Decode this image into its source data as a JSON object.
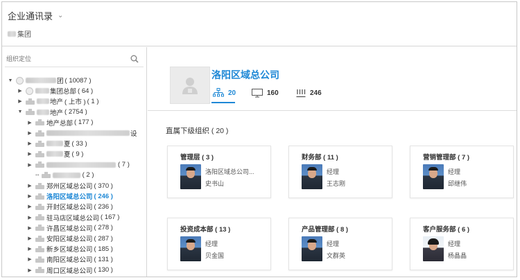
{
  "header": {
    "app_title": "企业通讯录",
    "org_name_suffix": "集团"
  },
  "sidebar": {
    "search_placeholder": "组织定位",
    "tree": [
      {
        "label": "团",
        "count": "( 10087 )",
        "level": 0,
        "expanded": true,
        "icon": "globe-icon",
        "blur": 44
      },
      {
        "label": "集团总部",
        "count": "( 64 )",
        "level": 1,
        "expanded": false,
        "icon": "globe-icon",
        "blur": 20
      },
      {
        "label": "地产",
        "count": "( 上市 )",
        "extra": "( 1 )",
        "level": 1,
        "expanded": false,
        "icon": "folder-icon",
        "blur": 18
      },
      {
        "label": "地产",
        "count": "( 2754 )",
        "level": 1,
        "expanded": true,
        "icon": "folder-icon",
        "blur": 18
      },
      {
        "label": "地产总部",
        "count": "( 177 )",
        "level": 2,
        "expanded": false,
        "icon": "folder-icon",
        "blur": 0
      },
      {
        "label": "设",
        "count": "",
        "level": 2,
        "expanded": false,
        "icon": "folder-icon",
        "blur": 120
      },
      {
        "label": "夏",
        "count": "( 33 )",
        "level": 2,
        "expanded": false,
        "icon": "folder-icon",
        "blur": 24
      },
      {
        "label": "夏",
        "count": "( 9 )",
        "level": 2,
        "expanded": false,
        "icon": "folder-icon",
        "blur": 24
      },
      {
        "label": "",
        "count": "( 7 )",
        "level": 2,
        "expanded": false,
        "icon": "folder-icon",
        "blur": 100
      },
      {
        "label": "",
        "count": "( 2 )",
        "level": 2,
        "expanded": false,
        "icon": "folder-icon",
        "blur": 40,
        "dots": true
      },
      {
        "label": "郑州区域总公司",
        "count": "( 370 )",
        "level": 2,
        "expanded": false,
        "icon": "folder-icon",
        "blur": 0
      },
      {
        "label": "洛阳区域总公司",
        "count": "( 246 )",
        "level": 2,
        "expanded": false,
        "icon": "folder-icon",
        "blur": 0,
        "active": true
      },
      {
        "label": "开封区域总公司",
        "count": "( 236 )",
        "level": 2,
        "expanded": false,
        "icon": "folder-icon",
        "blur": 0
      },
      {
        "label": "驻马店区域总公司",
        "count": "( 167 )",
        "level": 2,
        "expanded": false,
        "icon": "folder-icon",
        "blur": 0
      },
      {
        "label": "许昌区域总公司",
        "count": "( 278 )",
        "level": 2,
        "expanded": false,
        "icon": "folder-icon",
        "blur": 0
      },
      {
        "label": "安阳区域总公司",
        "count": "( 287 )",
        "level": 2,
        "expanded": false,
        "icon": "folder-icon",
        "blur": 0
      },
      {
        "label": "新乡区域总公司",
        "count": "( 185 )",
        "level": 2,
        "expanded": false,
        "icon": "folder-icon",
        "blur": 0
      },
      {
        "label": "南阳区域总公司",
        "count": "( 131 )",
        "level": 2,
        "expanded": false,
        "icon": "folder-icon",
        "blur": 0
      },
      {
        "label": "周口区域总公司",
        "count": "( 130 )",
        "level": 2,
        "expanded": false,
        "icon": "folder-icon",
        "blur": 0
      }
    ]
  },
  "main": {
    "company_name": "洛阳区域总公司",
    "stats": {
      "org_count": "20",
      "device_count": "160",
      "member_count": "246"
    },
    "section_title": "直属下级组织 ( 20 )",
    "cards": [
      {
        "title": "管理层 ( 3 )",
        "role": "洛阳区域总公司...",
        "person": "史书山",
        "female": false
      },
      {
        "title": "财务部 ( 11 )",
        "role": "经理",
        "person": "王志刚",
        "female": false
      },
      {
        "title": "营销管理部 ( 7 )",
        "role": "经理",
        "person": "邱继伟",
        "female": false
      },
      {
        "title": "投资成本部 ( 13 )",
        "role": "经理",
        "person": "贝金国",
        "female": false
      },
      {
        "title": "产品管理部 ( 8 )",
        "role": "经理",
        "person": "文群英",
        "female": false
      },
      {
        "title": "客户服务部 ( 6 )",
        "role": "经理",
        "person": "杨晶晶",
        "female": true
      }
    ]
  },
  "colors": {
    "accent": "#1e88d6",
    "border": "#d6d6d6"
  }
}
